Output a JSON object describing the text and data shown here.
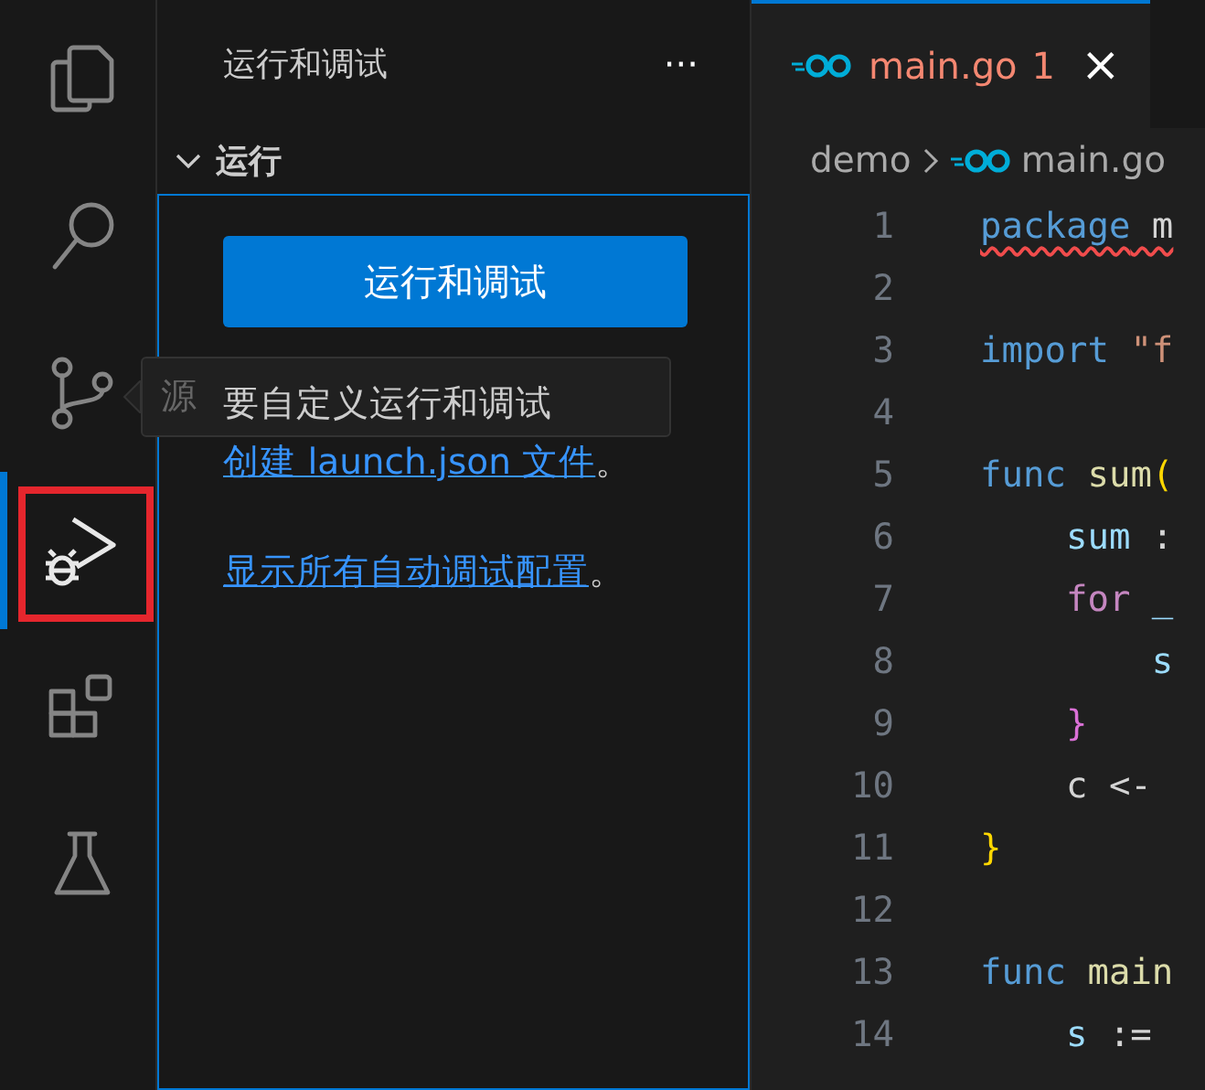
{
  "activity_bar": {
    "items": [
      {
        "kind": "files",
        "selected": false,
        "highlighted": false
      },
      {
        "kind": "search",
        "selected": false,
        "highlighted": false
      },
      {
        "kind": "source-control",
        "selected": false,
        "highlighted": false
      },
      {
        "kind": "run-debug",
        "selected": true,
        "highlighted": true
      },
      {
        "kind": "extensions",
        "selected": false,
        "highlighted": false
      },
      {
        "kind": "testing",
        "selected": false,
        "highlighted": false
      }
    ]
  },
  "tooltip": {
    "text": "源"
  },
  "sidebar": {
    "title": "运行和调试",
    "more": "···",
    "section": {
      "title": "运行",
      "expanded": true,
      "button": "运行和调试",
      "paragraph": {
        "text": "要自定义运行和调试",
        "link": "创建 launch.json 文件",
        "end": "。"
      },
      "link2": {
        "link": "显示所有自动调试配置",
        "end": "。"
      }
    }
  },
  "editor": {
    "tabs": [
      {
        "label": "main.go",
        "problems": "1",
        "close": "×",
        "selected": true
      }
    ],
    "breadcrumb": [
      {
        "text": "demo",
        "kind": "folder"
      },
      {
        "text": "main.go",
        "kind": "file"
      }
    ],
    "lines": [
      {
        "number": "1",
        "error": true,
        "tokens": [
          {
            "text": "package",
            "kind": "keyword"
          },
          {
            "text": " m",
            "kind": "plain"
          }
        ]
      },
      {
        "number": "2",
        "error": false
      },
      {
        "number": "3",
        "error": false,
        "tokens": [
          {
            "text": "import",
            "kind": "keyword"
          },
          {
            "text": " \"f",
            "kind": "string"
          }
        ]
      },
      {
        "number": "4",
        "error": false
      },
      {
        "number": "5",
        "error": false,
        "tokens": [
          {
            "text": "func",
            "kind": "keyword"
          },
          {
            "text": " sum",
            "kind": "function"
          },
          {
            "text": "(",
            "kind": "bracket1"
          }
        ]
      },
      {
        "number": "6",
        "error": false,
        "tokens": [
          {
            "text": "    sum",
            "kind": "variable"
          },
          {
            "text": " :",
            "kind": "plain"
          }
        ]
      },
      {
        "number": "7",
        "error": false,
        "tokens": [
          {
            "text": "    for",
            "kind": "control"
          },
          {
            "text": " _",
            "kind": "variable"
          }
        ]
      },
      {
        "number": "8",
        "error": false,
        "tokens": [
          {
            "text": "        s",
            "kind": "variable"
          }
        ]
      },
      {
        "number": "9",
        "error": false,
        "tokens": [
          {
            "text": "    }",
            "kind": "bracket2"
          }
        ]
      },
      {
        "number": "10",
        "error": false,
        "tokens": [
          {
            "text": "    c <-",
            "kind": "plain"
          }
        ]
      },
      {
        "number": "11",
        "error": false,
        "tokens": [
          {
            "text": "}",
            "kind": "bracket1"
          }
        ]
      },
      {
        "number": "12",
        "error": false
      },
      {
        "number": "13",
        "error": false,
        "tokens": [
          {
            "text": "func",
            "kind": "keyword"
          },
          {
            "text": " main",
            "kind": "function"
          }
        ]
      },
      {
        "number": "14",
        "error": false,
        "tokens": [
          {
            "text": "    s",
            "kind": "variable"
          },
          {
            "text": " :=",
            "kind": "plain"
          }
        ]
      }
    ]
  }
}
